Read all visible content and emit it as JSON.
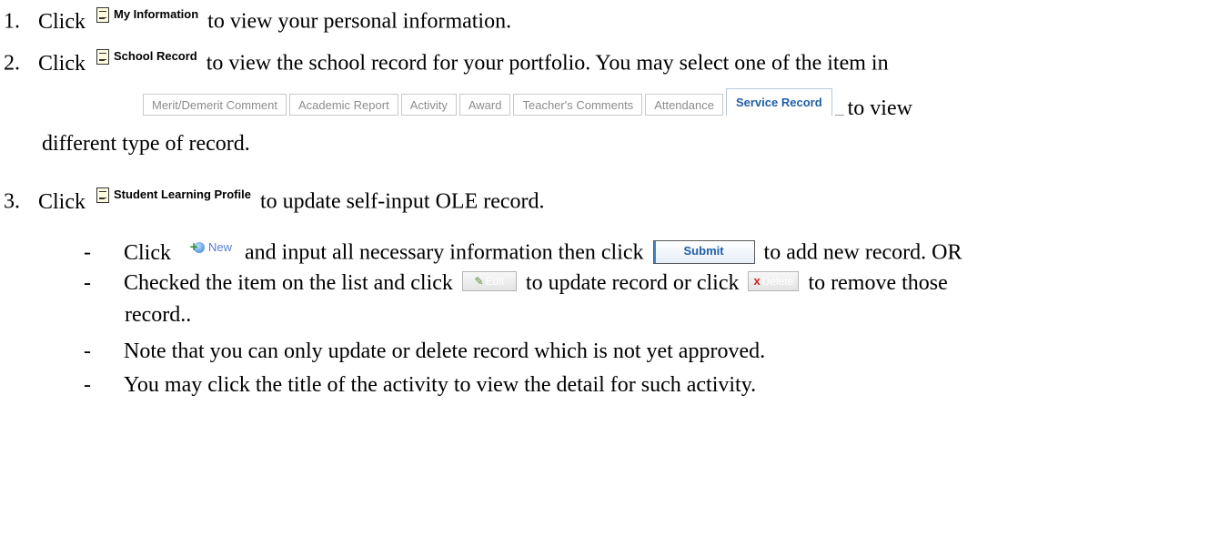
{
  "steps": [
    {
      "number": "1.",
      "prefix": "Click",
      "button_label": "My Information",
      "suffix": "to view your personal information."
    },
    {
      "number": "2.",
      "prefix": "Click",
      "button_label": "School Record",
      "suffix": "to view the school record for your portfolio. You may select one of the item in",
      "tabs_suffix": "to view",
      "continuation": "different type of record."
    },
    {
      "number": "3.",
      "prefix": "Click",
      "button_label": "Student Learning Profile",
      "suffix": "to update self-input OLE record."
    }
  ],
  "tabs": [
    "Merit/Demerit Comment",
    "Academic Report",
    "Activity",
    "Award",
    "Teacher's Comments",
    "Attendance",
    "Service Record"
  ],
  "active_tab": "Service Record",
  "bullets": {
    "dash": "-",
    "b1_prefix": "Click",
    "new_label": "New",
    "b1_middle": "and input all necessary information then click",
    "submit_label": "Submit",
    "b1_suffix": "to add new record. OR",
    "b2_prefix": "Checked the item on the list and click",
    "edit_label": "Edit",
    "b2_middle": "to update record or click",
    "delete_label": "Delete",
    "b2_suffix": "to remove those",
    "b2_continuation": "record..",
    "b3": "Note that you can only update or delete record which is not yet approved.",
    "b4": "You may click the title of the activity to view the detail for such activity."
  },
  "colors": {
    "active_tab_text": "#1f5fa6",
    "inactive_tab_text": "#8c8c8c",
    "new_text": "#5a7dd6",
    "delete_x": "#d82020"
  }
}
